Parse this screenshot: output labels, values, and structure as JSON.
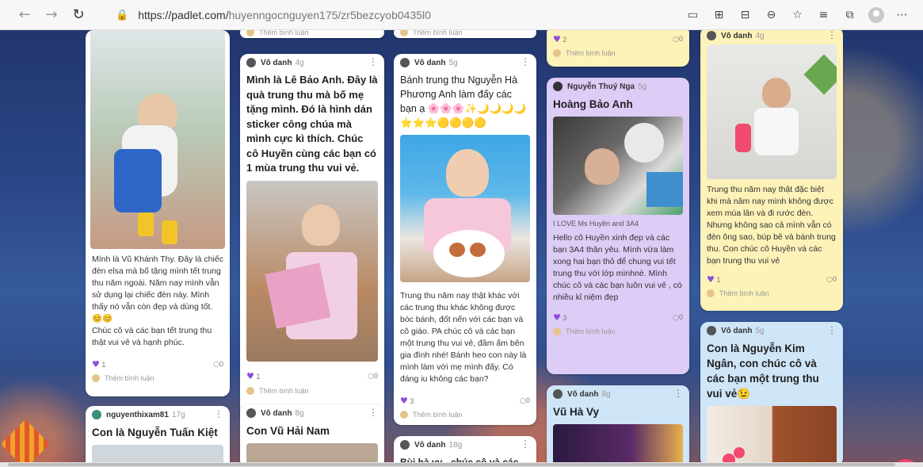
{
  "browser": {
    "url_scheme": "https://padlet.com/",
    "url_path": "huyenngocnguyen175/zr5bezcyob0435l0"
  },
  "colors": {
    "accent": "#f0456e",
    "heart": "#8b4fd6",
    "card_yellow": "#fdf2b8",
    "card_purple": "#dcccf6",
    "card_blue": "#cfe5f8"
  },
  "common": {
    "comment_prompt": "Thêm bình luận",
    "anon": "Vô danh"
  },
  "posts": {
    "c1a": {
      "body": "Mình là Vũ Khánh Thy. Đây là chiếc đèn elsa mà bố tặng mình tết trung thu năm ngoái. Năm nay mình vẫn sử dụng lại chiếc đèn này. Mình thấy nó vẫn còn đẹp và dùng tốt. 😊😊\nChúc cô và các bạn tết trung thu thật vui vẻ và hạnh phúc.",
      "likes": "1",
      "comments": "0"
    },
    "c1b": {
      "author": "nguyenthixam81",
      "time": "17g",
      "title": "Con là Nguyễn Tuấn Kiệt"
    },
    "c2a": {
      "time": "4g",
      "title": "Mình là Lê Bảo Anh. Đây là quà trung thu mà bố mẹ tặng mình. Đó là hình dán sticker công chúa mà mình cực kì thích. Chúc cô Huyền cùng các bạn có 1 mùa trung thu vui vẻ.",
      "likes": "1",
      "comments": "0"
    },
    "c2b": {
      "time": "8g",
      "title": "Con Vũ Hải Nam"
    },
    "c3a": {
      "time": "5g",
      "title": "Bánh trung thu Nguyễn Hà Phương Anh làm đấy các bạn ạ 🌸🌸🌸✨🌙🌙🌙🌙⭐⭐⭐🟡🟡🟡🟡",
      "body": "Trung thu năm nay thật khác với các trung thu khác không được bóc bánh, đốt nến với các bạn và cô giáo. PA chúc cô và các bạn một trung thu vui vẻ, đầm ấm bên gia đình nhé! Bánh heo con này là mình làm với mẹ mình đấy. Có đáng iu không các bạn?",
      "likes": "3",
      "comments": "0"
    },
    "c3b": {
      "time": "18g",
      "title": "Bùi hà vy - chúc cô và các"
    },
    "c4a": {
      "likes": "2",
      "comments": "0"
    },
    "c4b": {
      "author": "Nguyễn Thuý Nga",
      "time": "5g",
      "title": "Hoàng Bảo Anh",
      "caption": "I LOVE Ms Huyền and 3A4",
      "body": "Hello cô Huyền xinh đẹp và các bạn 3A4 thân yêu. Mình vừa làm xong hai bạn thỏ để chung vui tết trung thu với lớp mìnhnè. Mình chúc cô và các bạn luôn vui vẻ , có nhiều kỉ niệm đẹp",
      "likes": "3",
      "comments": "0"
    },
    "c4c": {
      "time": "8g",
      "title": "Vũ Hà Vy"
    },
    "c5a": {
      "time": "4g",
      "body": "Trung thu năm nay thật đặc biệt khi mà năm nay mình không được xem múa lân và đi rước đèn. Nhưng không sao cả mình vẫn có đèn ông sao, búp bê và bánh trung thu. Con chúc cô Huyền và các bạn trung thu vui vẻ",
      "likes": "1",
      "comments": "0"
    },
    "c5b": {
      "time": "5g",
      "title": "Con là Nguyễn Kim Ngân, con chúc cô và các bạn một trung thu vui vẻ😉"
    }
  }
}
